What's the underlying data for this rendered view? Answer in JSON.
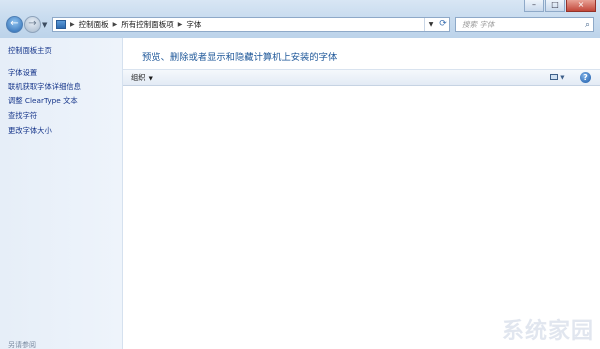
{
  "address_bar": {
    "breadcrumbs": [
      "控制面板",
      "所有控制面板项",
      "字体"
    ]
  },
  "search": {
    "placeholder": "搜索 字体"
  },
  "left_pane": {
    "home": "控制面板主页",
    "links": [
      "字体设置",
      "联机获取字体详细信息",
      "调整 ClearType 文本",
      "查找字符",
      "更改字体大小"
    ],
    "see_also": "另请参阅"
  },
  "main": {
    "headline": "预览、删除或者显示和隐藏计算机上安装的字体"
  },
  "toolbar": {
    "organize": "组织"
  },
  "watermark": "系统家园",
  "colors": {
    "link": "#15358a",
    "headline": "#1e5799",
    "left_pane_bg": "#e6eef8"
  },
  "icons": {
    "back": "back-arrow-icon",
    "forward": "forward-arrow-icon",
    "refresh": "refresh-icon",
    "search": "magnifier-icon",
    "help": "help-icon",
    "view": "view-options-icon"
  }
}
